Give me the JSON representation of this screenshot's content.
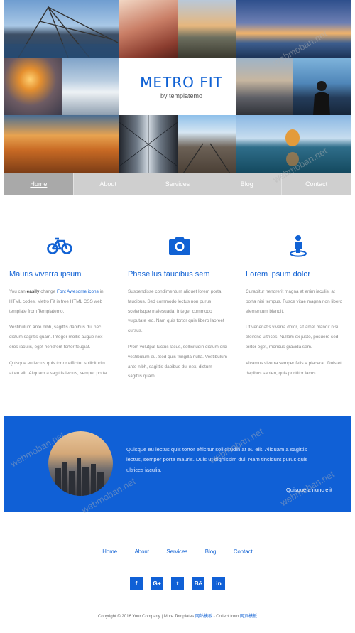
{
  "brand": {
    "title": "METRO FIT",
    "subtitle": "by templatemo"
  },
  "nav": [
    {
      "label": "Home",
      "active": true
    },
    {
      "label": "About",
      "active": false
    },
    {
      "label": "Services",
      "active": false
    },
    {
      "label": "Blog",
      "active": false
    },
    {
      "label": "Contact",
      "active": false
    }
  ],
  "features": [
    {
      "icon": "bicycle-icon",
      "title": "Mauris viverra ipsum",
      "p1_pre": "You can ",
      "p1_bold": "easily",
      "p1_mid": " change ",
      "p1_link": "Font Awesome icons",
      "p1_post": " in HTML codes. Metro Fit is free HTML CSS web template from Templatemo.",
      "p2": "Vestibulum ante nibh, sagittis dapibus dui nec, dictum sagittis quam. Integer mollis augue nex eros iaculis, eget hendrerit tortor feugiat.",
      "p3": "Quisque eu lectus quis tortor efficitur sollicitudin at eu elit. Aliquam a sagittis lectus, semper porta."
    },
    {
      "icon": "camera-icon",
      "title": "Phasellus faucibus sem",
      "p1": "Suspendisse condimentum aliquet lorem porta faucibus. Sed commodo lectus non purus scelerisque malesuada. Integer commodo vulputate leo. Nam quis tortor quis libero laoreet cursus.",
      "p2": "Proin volutpat luctus lacus, sollicitudin dictum orci vestibulum eu. Sed quis fringilla nulla. Vestibulum ante nibh, sagittis dapibus dui nex, dictum sagittis quam."
    },
    {
      "icon": "street-view-icon",
      "title": "Lorem ipsum dolor",
      "p1": "Curabitur hendrerit magna at enim iaculis, at porta nisi tempus. Fusce vitae magna non libero elementum blandit.",
      "p2": "Ut venenatis viverra dolor, sit amet blandit nisi eleifend ultrices. Nullam ex justo, posuere sed tortor eget, rhoncus gravida sem.",
      "p3": "Vivamus viverra semper felis a placerat. Duis et dapibus sapien, quis porttitor lacus."
    }
  ],
  "testimonial": {
    "quote": "Quisque eu lectus quis tortor efficitur sollicitudin at eu elit. Aliquam a sagittis lectus, semper porta mauris. Duis ut dignissim dui. Nam tincidunt purus quis ultrices iaculis.",
    "author": "Quisque a nunc elit"
  },
  "footer_nav": [
    "Home",
    "About",
    "Services",
    "Blog",
    "Contact"
  ],
  "social": [
    {
      "icon": "facebook-icon",
      "glyph": "f"
    },
    {
      "icon": "google-plus-icon",
      "glyph": "G+"
    },
    {
      "icon": "twitter-icon",
      "glyph": "t"
    },
    {
      "icon": "behance-icon",
      "glyph": "Bē"
    },
    {
      "icon": "linkedin-icon",
      "glyph": "in"
    }
  ],
  "copyright": {
    "pre": "Copyright © 2016 Your Company | More Templates ",
    "link1": "网站模板",
    "mid": " - Collect from ",
    "link2": "网页模板"
  },
  "watermark": "webmoban.net",
  "colors": {
    "accent": "#1162d4",
    "band": "#1060d6",
    "nav": "#cfcfcf",
    "nav_active": "#a9a9a9"
  }
}
